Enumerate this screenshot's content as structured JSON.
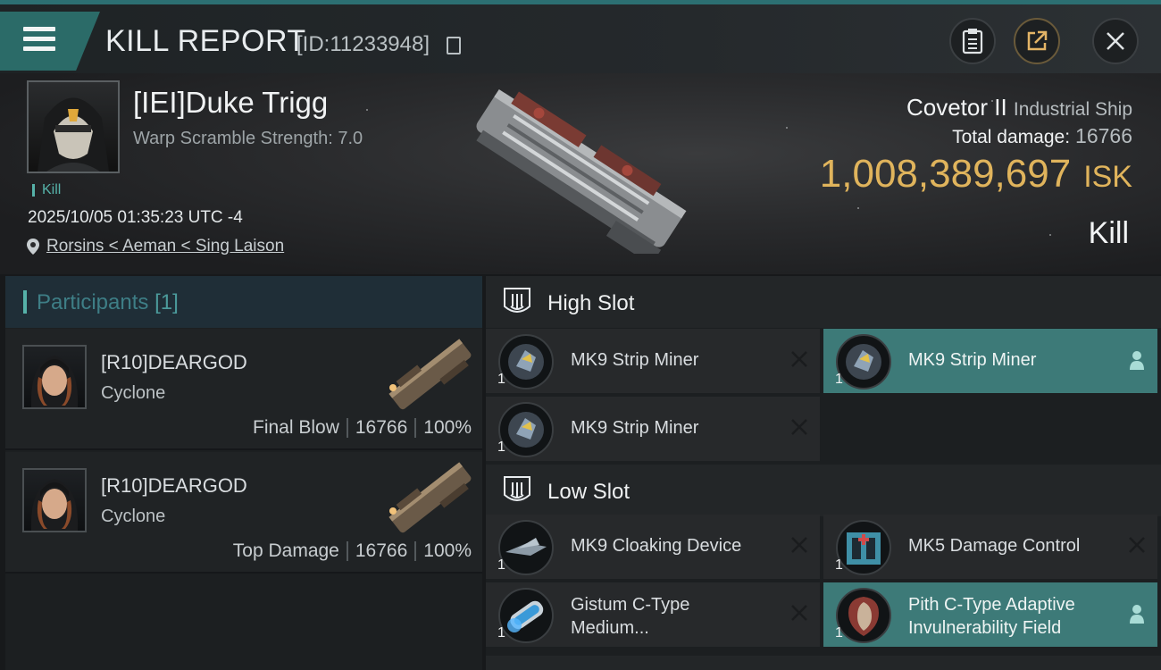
{
  "header": {
    "title": "KILL REPORT",
    "report_id": "[ID:11233948]",
    "icons": [
      "menu-icon",
      "copy-icon",
      "clipboard-icon",
      "share-icon",
      "close-icon"
    ]
  },
  "victim": {
    "name": "[IEI]Duke Trigg",
    "warp_scramble": "Warp Scramble Strength: 7.0",
    "tag": "Kill",
    "datetime": "2025/10/05 01:35:23 UTC -4",
    "location": "Rorsins < Aeman < Sing Laison",
    "ship_name": "Covetor II",
    "ship_class": "Industrial Ship",
    "total_damage_label": "Total damage:",
    "total_damage": "16766",
    "isk_value": "1,008,389,697",
    "isk_unit": "ISK",
    "kill_type": "Kill"
  },
  "participants": {
    "label": "Participants",
    "count": "[1]",
    "rows": [
      {
        "name": "[R10]DEARGOD",
        "ship": "Cyclone",
        "role": "Final Blow",
        "damage": "16766",
        "percent": "100%"
      },
      {
        "name": "[R10]DEARGOD",
        "ship": "Cyclone",
        "role": "Top Damage",
        "damage": "16766",
        "percent": "100%"
      }
    ]
  },
  "slots": {
    "high": {
      "label": "High Slot",
      "modules": [
        {
          "name": "MK9 Strip Miner",
          "qty": "1",
          "state": "destroyed"
        },
        {
          "name": "MK9 Strip Miner",
          "qty": "1",
          "state": "dropped"
        },
        {
          "name": "MK9 Strip Miner",
          "qty": "1",
          "state": "destroyed"
        }
      ]
    },
    "low": {
      "label": "Low Slot",
      "modules": [
        {
          "name": "MK9 Cloaking Device",
          "qty": "1",
          "state": "destroyed"
        },
        {
          "name": "MK5 Damage Control",
          "qty": "1",
          "state": "destroyed"
        },
        {
          "name": "Gistum C-Type Medium...",
          "qty": "1",
          "state": "destroyed"
        },
        {
          "name": "Pith C-Type Adaptive Invulnerability Field",
          "qty": "1",
          "state": "dropped"
        }
      ]
    }
  },
  "colors": {
    "accent": "#56b2a9",
    "isk": "#e0b45c",
    "dropped_bg": "#3d7a78",
    "menu_bg": "#2b6b68"
  }
}
